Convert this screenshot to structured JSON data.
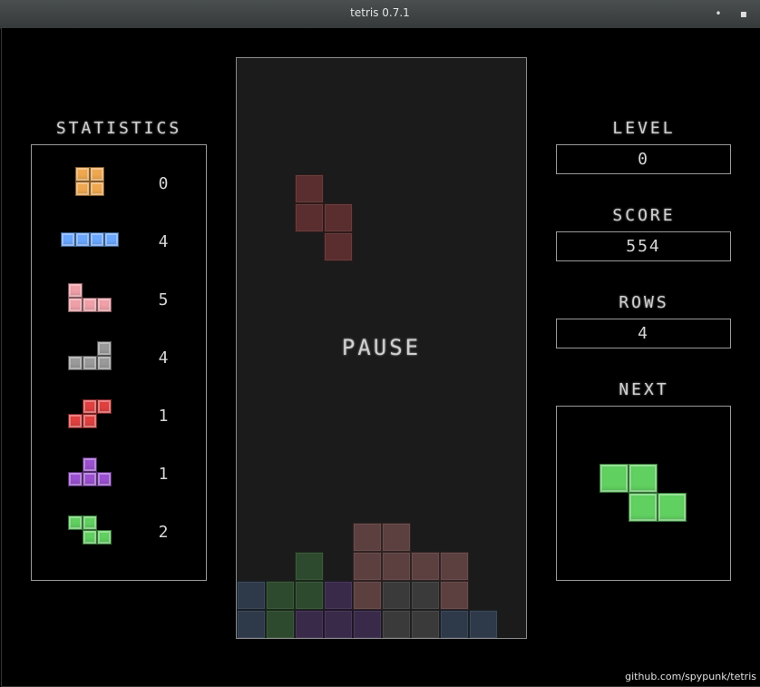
{
  "window": {
    "title": "tetris 0.7.1",
    "min_glyph": "•",
    "max_glyph": "▪"
  },
  "statistics": {
    "title": "STATISTICS",
    "pieces": [
      {
        "shape": "O",
        "color": "#f0a850",
        "count": "0"
      },
      {
        "shape": "I",
        "color": "#6aa8ff",
        "count": "4"
      },
      {
        "shape": "J",
        "color": "#f0a0a8",
        "count": "5"
      },
      {
        "shape": "L",
        "color": "#9a9a9a",
        "count": "4"
      },
      {
        "shape": "S",
        "color": "#e04040",
        "count": "1"
      },
      {
        "shape": "T",
        "color": "#9a50d0",
        "count": "1"
      },
      {
        "shape": "Z",
        "color": "#60d060",
        "count": "2"
      }
    ]
  },
  "board": {
    "pause_text": "PAUSE",
    "columns": 10,
    "rows": 20,
    "active_piece": {
      "color": "#5a2e2e",
      "cells": [
        [
          2,
          4
        ],
        [
          2,
          5
        ],
        [
          3,
          5
        ],
        [
          3,
          6
        ]
      ]
    },
    "stack": [
      {
        "color": "#5c3f3f",
        "cells": [
          [
            4,
            16
          ],
          [
            5,
            16
          ],
          [
            4,
            17
          ],
          [
            5,
            17
          ],
          [
            6,
            17
          ],
          [
            7,
            17
          ],
          [
            4,
            18
          ],
          [
            7,
            18
          ]
        ]
      },
      {
        "color": "#2e4a2e",
        "cells": [
          [
            2,
            17
          ],
          [
            1,
            18
          ],
          [
            2,
            18
          ],
          [
            1,
            19
          ]
        ]
      },
      {
        "color": "#3a3a3a",
        "cells": [
          [
            5,
            18
          ],
          [
            6,
            18
          ],
          [
            5,
            19
          ],
          [
            6,
            19
          ]
        ]
      },
      {
        "color": "#3a2a4a",
        "cells": [
          [
            3,
            18
          ],
          [
            2,
            19
          ],
          [
            3,
            19
          ],
          [
            4,
            19
          ]
        ]
      },
      {
        "color": "#2e3a4a",
        "cells": [
          [
            0,
            18
          ],
          [
            0,
            19
          ],
          [
            7,
            19
          ],
          [
            8,
            19
          ]
        ]
      }
    ]
  },
  "level": {
    "label": "LEVEL",
    "value": "0"
  },
  "score": {
    "label": "SCORE",
    "value": "554"
  },
  "rows": {
    "label": "ROWS",
    "value": "4"
  },
  "next": {
    "label": "NEXT",
    "shape": "Z",
    "color": "#60d060"
  },
  "footer": "github.com/spypunk/tetris"
}
